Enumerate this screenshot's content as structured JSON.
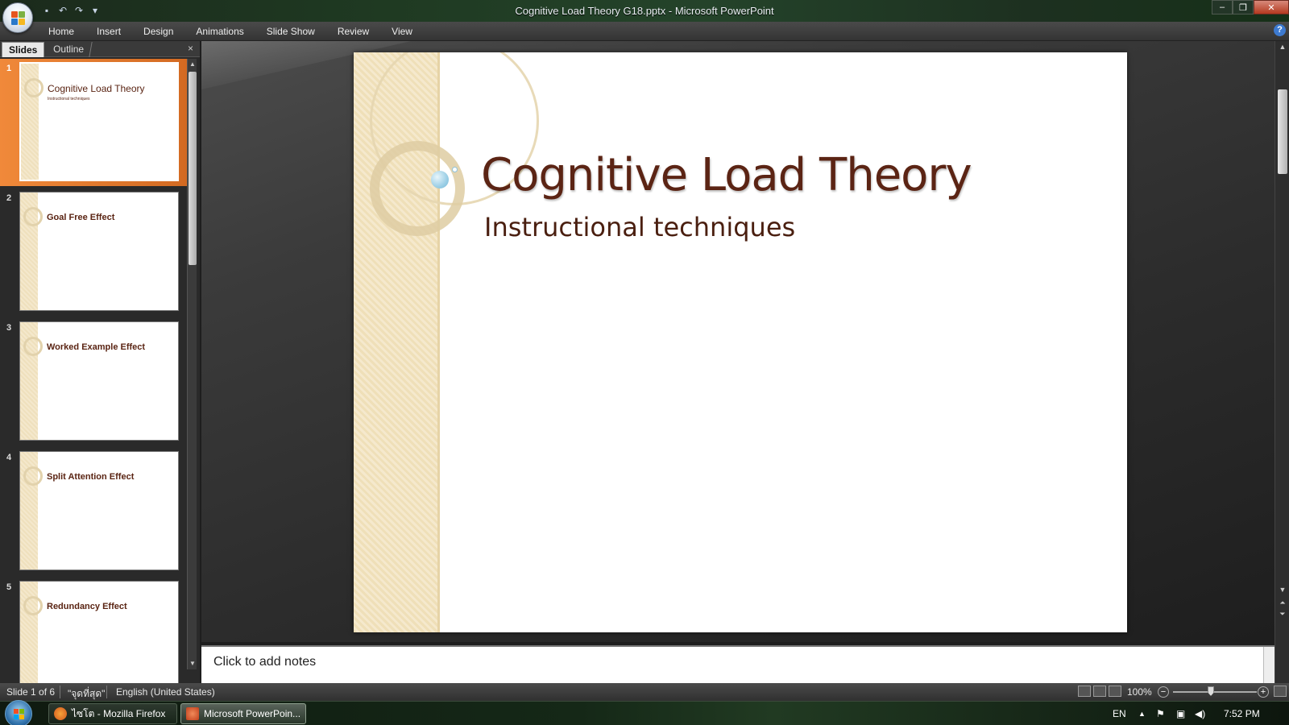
{
  "window": {
    "title": "Cognitive Load Theory G18.pptx - Microsoft PowerPoint",
    "minimize_glyph": "‒",
    "maximize_glyph": "❐",
    "close_glyph": "✕"
  },
  "qat": {
    "save_icon": "▪",
    "undo_icon": "↶",
    "redo_icon": "↷",
    "customize_icon": "▾"
  },
  "ribbon": {
    "tabs": [
      "Home",
      "Insert",
      "Design",
      "Animations",
      "Slide Show",
      "Review",
      "View"
    ],
    "help_label": "?"
  },
  "panel": {
    "tab_slides": "Slides",
    "tab_outline": "Outline",
    "close_glyph": "×",
    "slides": [
      {
        "num": "1",
        "title": "Cognitive Load Theory",
        "subtitle": "Instructional techniques"
      },
      {
        "num": "2",
        "title": "Goal Free Effect"
      },
      {
        "num": "3",
        "title": "Worked Example Effect"
      },
      {
        "num": "4",
        "title": "Split Attention Effect"
      },
      {
        "num": "5",
        "title": "Redundancy Effect"
      }
    ]
  },
  "slide": {
    "title": "Cognitive Load Theory",
    "subtitle": "Instructional techniques"
  },
  "notes": {
    "placeholder": "Click to add notes"
  },
  "status": {
    "slide_info": "Slide 1 of 6",
    "theme": "\"จุดที่สุด\"",
    "language": "English (United States)",
    "zoom": "100%",
    "zoom_out": "−",
    "zoom_in": "+"
  },
  "taskbar": {
    "firefox_label": "ไซโต - Mozilla Firefox",
    "powerpoint_label": "Microsoft PowerPoin...",
    "lang": "EN",
    "clock": "7:52 PM"
  },
  "colors": {
    "slide_title": "#5b2414",
    "accent_selected": "#f0893a"
  }
}
